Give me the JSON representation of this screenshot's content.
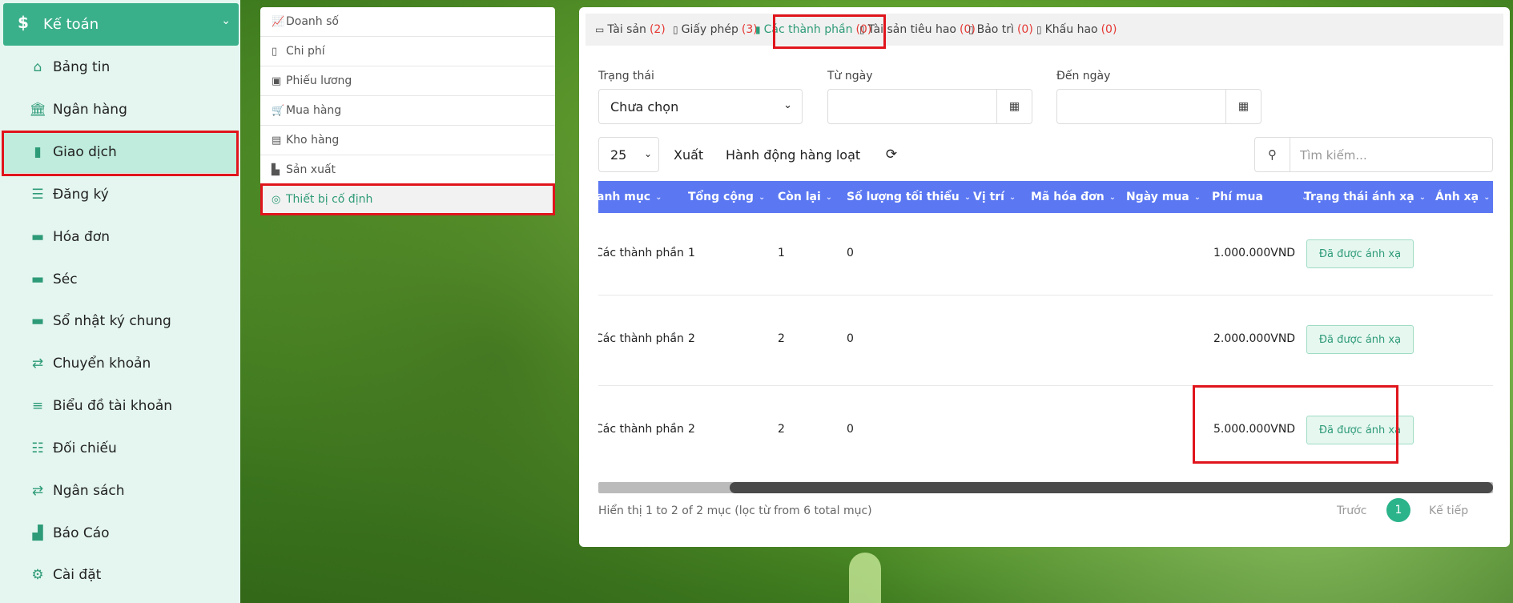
{
  "sidebar": {
    "header": {
      "icon": "dollar-icon",
      "label": "Kế toán"
    },
    "items": [
      {
        "icon": "home-icon",
        "label": "Bảng tin"
      },
      {
        "icon": "bank-icon",
        "label": "Ngân hàng"
      },
      {
        "icon": "file-icon",
        "label": "Giao dịch"
      },
      {
        "icon": "list-icon",
        "label": "Đăng ký"
      },
      {
        "icon": "book-icon",
        "label": "Hóa đơn"
      },
      {
        "icon": "book-icon",
        "label": "Séc"
      },
      {
        "icon": "book-icon",
        "label": "Sổ nhật ký chung"
      },
      {
        "icon": "exchange-icon",
        "label": "Chuyển khoản"
      },
      {
        "icon": "ordered-list-icon",
        "label": "Biểu đồ tài khoản"
      },
      {
        "icon": "sliders-icon",
        "label": "Đối chiếu"
      },
      {
        "icon": "exchange-icon",
        "label": "Ngân sách"
      },
      {
        "icon": "area-chart-icon",
        "label": "Báo Cáo"
      },
      {
        "icon": "gear-icon",
        "label": "Cài đặt"
      }
    ],
    "active_index": 2
  },
  "submenu": {
    "items": [
      {
        "icon": "line-chart-icon",
        "label": "Doanh số"
      },
      {
        "icon": "file-icon",
        "label": "Chi phí"
      },
      {
        "icon": "money-icon",
        "label": "Phiếu lương"
      },
      {
        "icon": "cart-icon",
        "label": "Mua hàng"
      },
      {
        "icon": "warehouse-icon",
        "label": "Kho hàng"
      },
      {
        "icon": "industry-icon",
        "label": "Sản xuất"
      },
      {
        "icon": "target-icon",
        "label": "Thiết bị cố định"
      }
    ],
    "active_index": 6
  },
  "tabs": [
    {
      "icon": "credit-card-icon",
      "label": "Tài sản",
      "count": "(2)"
    },
    {
      "icon": "file-icon",
      "label": "Giấy phép",
      "count": "(3)"
    },
    {
      "icon": "file-icon",
      "label": "Các thành phần",
      "count": "(0)"
    },
    {
      "icon": "file-icon",
      "label": "Tài sản tiêu hao",
      "count": "(0)"
    },
    {
      "icon": "file-icon",
      "label": "Bảo trì",
      "count": "(0)"
    },
    {
      "icon": "file-icon",
      "label": "Khấu hao",
      "count": "(0)"
    }
  ],
  "filters": {
    "status_label": "Trạng thái",
    "status_value": "Chưa chọn",
    "from_label": "Từ ngày",
    "to_label": "Đến ngày"
  },
  "toolbar": {
    "page_size": "25",
    "export_label": "Xuất",
    "bulk_label": "Hành động hàng loạt",
    "search_placeholder": "Tìm kiếm..."
  },
  "table": {
    "columns": [
      "anh mục",
      "Tổng cộng",
      "Còn lại",
      "Số lượng tối thiểu",
      "Vị trí",
      "Mã hóa đơn",
      "Ngày mua",
      "Phí mua",
      "Trạng thái ánh xạ",
      "Ánh xạ"
    ],
    "rows": [
      {
        "category": "Các thành phần",
        "total": "1",
        "remaining": "1",
        "min_qty": "0",
        "cost": "1.000.000VND",
        "status": "Đã được ánh xạ"
      },
      {
        "category": "Các thành phần",
        "total": "2",
        "remaining": "2",
        "min_qty": "0",
        "cost": "2.000.000VND",
        "status": "Đã được ánh xạ"
      },
      {
        "category": "Các thành phần",
        "total": "2",
        "remaining": "2",
        "min_qty": "0",
        "cost": "5.000.000VND",
        "status": "Đã được ánh xạ"
      }
    ]
  },
  "footer": {
    "info": "Hiển thị 1 to 2 of 2 mục (lọc từ from 6 total mục)",
    "prev": "Trước",
    "page": "1",
    "next": "Kế tiếp"
  }
}
